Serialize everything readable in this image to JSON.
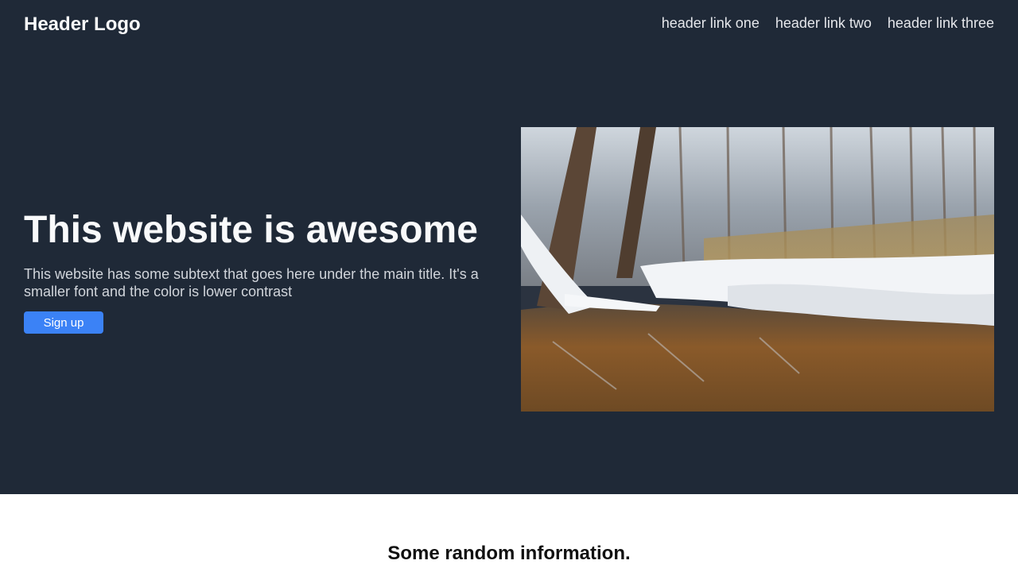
{
  "header": {
    "logo": "Header Logo",
    "links": [
      "header link one",
      "header link two",
      "header link three"
    ]
  },
  "hero": {
    "title": "This website is awesome",
    "subtext": "This website has some subtext that goes here under the main title. It's a smaller font and the color is lower contrast",
    "cta_label": "Sign up"
  },
  "info": {
    "heading": "Some random information."
  },
  "colors": {
    "hero_background": "#1f2937",
    "button": "#3b82f6",
    "page_background": "#ffffff"
  }
}
